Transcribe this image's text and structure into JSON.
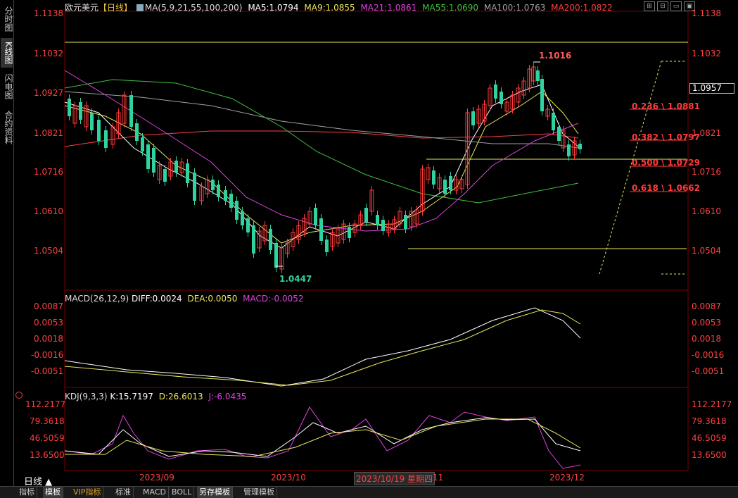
{
  "left_tabs": [
    "分时图",
    "K线图",
    "闪电图",
    "合约资料"
  ],
  "header": {
    "symbol": "欧元美元",
    "period": "【日线】",
    "ma_label": "MA(5,9,21,55,100,200)",
    "ma5": "MA5:1.0794",
    "ma9": "MA9:1.0855",
    "ma21": "MA21:1.0861",
    "ma55": "MA55:1.0690",
    "ma100": "MA100:1.0763",
    "ma200": "MA200:1.0822"
  },
  "window_buttons": [
    "⊞",
    "⊟",
    "▭",
    "▣"
  ],
  "price_axis": [
    "1.1138",
    "1.1032",
    "1.0927",
    "1.0821",
    "1.0716",
    "1.0610",
    "1.0504"
  ],
  "right_price_axis": [
    "1.1138",
    "1.1032",
    "1.0821",
    "1.0716",
    "1.0610",
    "1.0504"
  ],
  "current_price": "1.0957",
  "annotations": {
    "high": "1.1016",
    "low": "1.0447",
    "fib1": "0.236 \\ 1.0881",
    "fib2": "0.382 \\ 1.0797",
    "fib3": "0.500 \\ 1.0729",
    "fib4": "0.618 \\ 1.0662"
  },
  "macd": {
    "title": "MACD(26,12,9)",
    "diff": "DIFF:0.0024",
    "dea": "DEA:0.0050",
    "macd": "MACD:-0.0052",
    "axis": [
      "0.0087",
      "0.0053",
      "0.0018",
      "-0.0016",
      "-0.0051"
    ]
  },
  "kdj": {
    "title": "KDJ(9,3,3)",
    "k": "K:15.7197",
    "d": "D:26.6013",
    "j": "J:-6.0435",
    "axis": [
      "112.2177",
      "79.3618",
      "46.5059",
      "13.6500"
    ]
  },
  "time_axis": {
    "period_label": "日线 ▲",
    "labels": [
      "2023/09",
      "2023/10",
      "2023/10/19 星期四",
      "11",
      "2023/12"
    ]
  },
  "bottom_tabs": [
    "指标",
    "模板",
    "VIP指标",
    "标准",
    "MACD",
    "BOLL",
    "另存模板",
    "管理模板"
  ],
  "colors": {
    "up": "#ff3b3b",
    "down": "#2ed3a0",
    "ma5": "#ffffff",
    "ma9": "#e8e85a",
    "ma21": "#e040e0",
    "ma55": "#40c040",
    "ma100": "#a0a0a0",
    "ma200": "#ff4040",
    "axis_text": "#ff4040"
  }
}
